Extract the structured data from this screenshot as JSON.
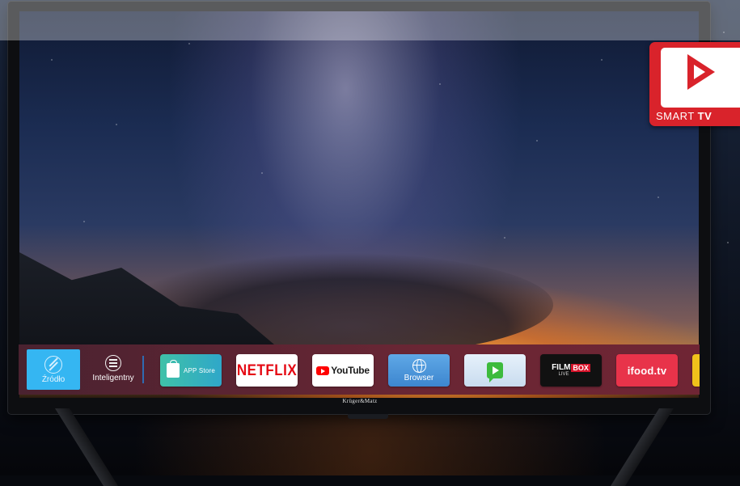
{
  "brand": "Krüger&Matz",
  "badge": {
    "word1": "SMART",
    "word2": "TV"
  },
  "app_bar": {
    "source_label": "Źródło",
    "smart_label": "Inteligentny",
    "apps": [
      {
        "name": "app-store",
        "label": "APP Store"
      },
      {
        "name": "netflix",
        "label": "NETFLIX"
      },
      {
        "name": "youtube",
        "label": "YouTube"
      },
      {
        "name": "browser",
        "label": "Browser"
      },
      {
        "name": "chat-app",
        "label": ""
      },
      {
        "name": "filmbox",
        "label_film": "FILM",
        "label_box": "BOX",
        "label_live": "LIVE"
      },
      {
        "name": "ifood",
        "label": "ifood.tv"
      }
    ]
  },
  "colors": {
    "bar_bg": "#6a2634",
    "source_tile": "#35b6f2",
    "netflix_red": "#e50914",
    "youtube_red": "#ff0000",
    "ifood_red": "#e8334a",
    "badge_red": "#d9232b",
    "divider_blue": "#2f6bb2"
  }
}
